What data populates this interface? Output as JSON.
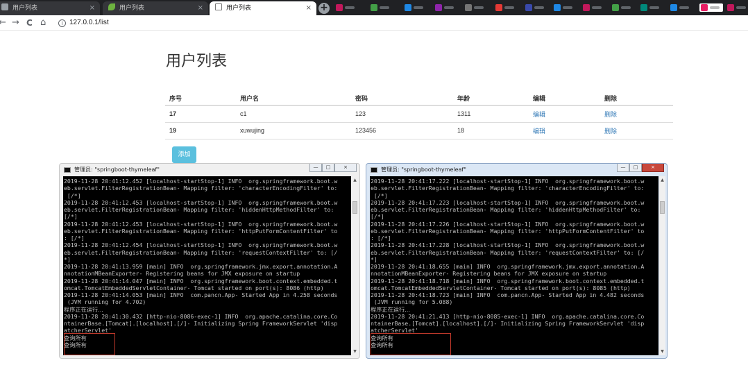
{
  "browser": {
    "tabs": [
      {
        "label": "用户列表",
        "active": false
      },
      {
        "label": "用户列表",
        "active": false
      },
      {
        "label": "用户列表",
        "active": true
      }
    ],
    "close_glyph": "×",
    "new_tab_glyph": "+",
    "nav": {
      "back": "←",
      "forward": "→",
      "reload": "C",
      "home": "⌂"
    },
    "address": "127.0.0.1/list",
    "info_glyph": "i"
  },
  "page": {
    "title": "用户列表",
    "table": {
      "headers": [
        "序号",
        "用户名",
        "密码",
        "年龄",
        "编辑",
        "删除"
      ],
      "rows": [
        {
          "id": "17",
          "username": "c1",
          "password": "123",
          "age": "1311",
          "edit": "编辑",
          "delete": "删除"
        },
        {
          "id": "19",
          "username": "xuwujing",
          "password": "123456",
          "age": "18",
          "edit": "编辑",
          "delete": "删除"
        }
      ]
    },
    "add_button": "添加",
    "link_color": "#337ab7",
    "add_button_color": "#5bc0de"
  },
  "consoles": [
    {
      "title": "管理员: \"springboot-thymeleaf\"",
      "controls": {
        "min": "—",
        "max": "□",
        "close": "×"
      },
      "lines": [
        "2019-11-28 20:41:12.452 [localhost-startStop-1] INFO  org.springframework.boot.w",
        "eb.servlet.FilterRegistrationBean- Mapping filter: 'characterEncodingFilter' to:",
        " [/*]",
        "2019-11-28 20:41:12.453 [localhost-startStop-1] INFO  org.springframework.boot.w",
        "eb.servlet.FilterRegistrationBean- Mapping filter: 'hiddenHttpMethodFilter' to:",
        "[/*]",
        "2019-11-28 20:41:12.453 [localhost-startStop-1] INFO  org.springframework.boot.w",
        "eb.servlet.FilterRegistrationBean- Mapping filter: 'httpPutFormContentFilter' to",
        ": [/*]",
        "2019-11-28 20:41:12.454 [localhost-startStop-1] INFO  org.springframework.boot.w",
        "eb.servlet.FilterRegistrationBean- Mapping filter: 'requestContextFilter' to: [/",
        "*]",
        "2019-11-28 20:41:13.959 [main] INFO  org.springframework.jmx.export.annotation.A",
        "nnotationMBeanExporter- Registering beans for JMX exposure on startup",
        "2019-11-28 20:41:14.047 [main] INFO  org.springframework.boot.context.embedded.t",
        "omcat.TomcatEmbeddedServletContainer- Tomcat started on port(s): 8086 (http)",
        "2019-11-28 20:41:14.053 [main] INFO  com.pancn.App- Started App in 4.258 seconds",
        " (JVM running for 4.702)",
        "程序正在运行...",
        "2019-11-28 20:41:30.432 [http-nio-8086-exec-1] INFO  org.apache.catalina.core.Co",
        "ntainerBase.[Tomcat].[localhost].[/]- Initializing Spring FrameworkServlet 'disp",
        "atcherServlet'",
        "查询所有",
        "查询所有"
      ]
    },
    {
      "title": "管理员: \"springboot-thymeleaf\"",
      "controls": {
        "min": "—",
        "max": "□",
        "close": "×"
      },
      "lines": [
        "2019-11-28 20:41:17.222 [localhost-startStop-1] INFO  org.springframework.boot.w",
        "eb.servlet.FilterRegistrationBean- Mapping filter: 'characterEncodingFilter' to:",
        " [/*]",
        "2019-11-28 20:41:17.223 [localhost-startStop-1] INFO  org.springframework.boot.w",
        "eb.servlet.FilterRegistrationBean- Mapping filter: 'hiddenHttpMethodFilter' to:",
        "[/*]",
        "2019-11-28 20:41:17.226 [localhost-startStop-1] INFO  org.springframework.boot.w",
        "eb.servlet.FilterRegistrationBean- Mapping filter: 'httpPutFormContentFilter' to",
        ": [/*]",
        "2019-11-28 20:41:17.228 [localhost-startStop-1] INFO  org.springframework.boot.w",
        "eb.servlet.FilterRegistrationBean- Mapping filter: 'requestContextFilter' to: [/",
        "*]",
        "2019-11-28 20:41:18.655 [main] INFO  org.springframework.jmx.export.annotation.A",
        "nnotationMBeanExporter- Registering beans for JMX exposure on startup",
        "2019-11-28 20:41:18.718 [main] INFO  org.springframework.boot.context.embedded.t",
        "omcat.TomcatEmbeddedServletContainer- Tomcat started on port(s): 8085 (http)",
        "2019-11-28 20:41:18.723 [main] INFO  com.pancn.App- Started App in 4.482 seconds",
        " (JVM running for 5.088)",
        "程序正在运行...",
        "2019-11-28 20:41:21.413 [http-nio-8085-exec-1] INFO  org.apache.catalina.core.Co",
        "ntainerBase.[Tomcat].[localhost].[/]- Initializing Spring FrameworkServlet 'disp",
        "atcherServlet'",
        "查询所有",
        "查询所有"
      ]
    }
  ]
}
